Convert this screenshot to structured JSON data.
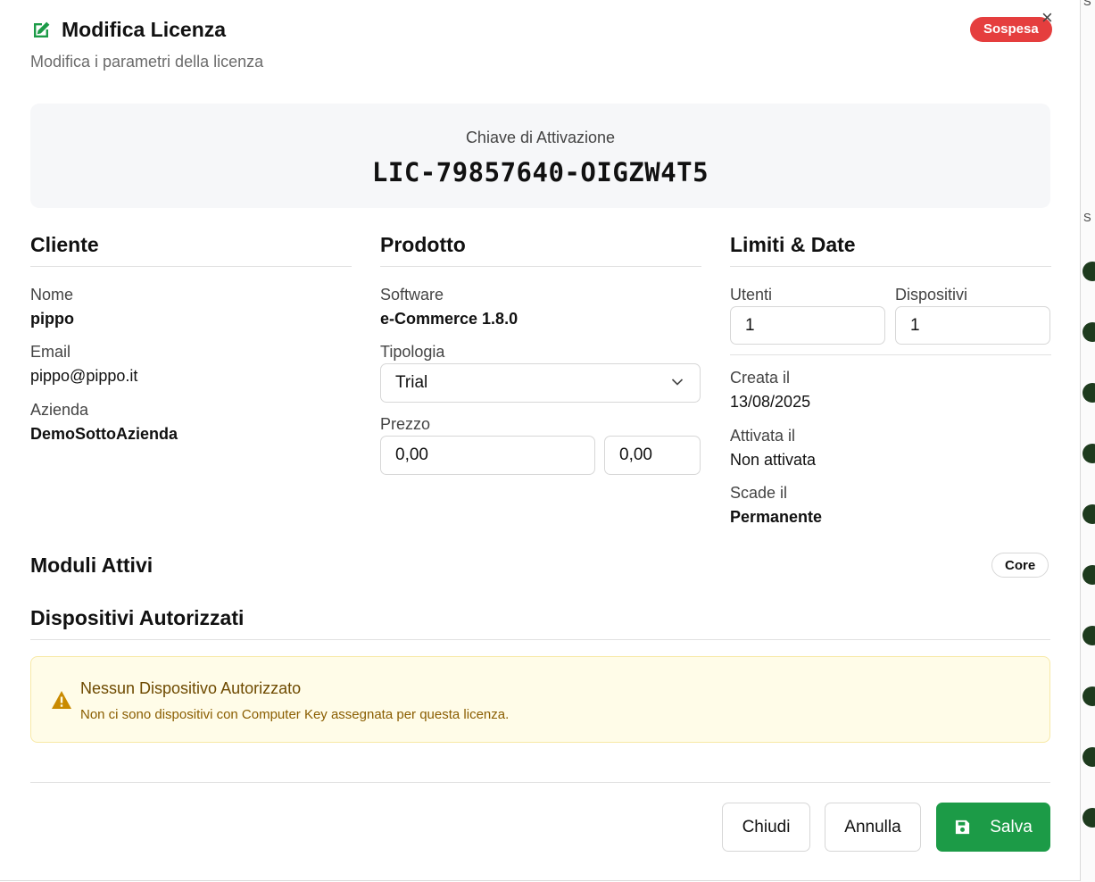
{
  "dialog": {
    "title": "Modifica Licenza",
    "subtitle": "Modifica i parametri della licenza",
    "status_badge": "Sospesa",
    "close_glyph": "×"
  },
  "activation": {
    "label": "Chiave di Attivazione",
    "key": "LIC-79857640-OIGZW4T5"
  },
  "cliente": {
    "heading": "Cliente",
    "nome_label": "Nome",
    "nome_value": "pippo",
    "email_label": "Email",
    "email_value": "pippo@pippo.it",
    "azienda_label": "Azienda",
    "azienda_value": "DemoSottoAzienda"
  },
  "prodotto": {
    "heading": "Prodotto",
    "software_label": "Software",
    "software_value": "e-Commerce 1.8.0",
    "tipologia_label": "Tipologia",
    "tipologia_value": "Trial",
    "prezzo_label": "Prezzo",
    "prezzo_value": "0,00",
    "prezzo_secondary_value": "0,00"
  },
  "limiti": {
    "heading": "Limiti & Date",
    "utenti_label": "Utenti",
    "utenti_value": "1",
    "dispositivi_label": "Dispositivi",
    "dispositivi_value": "1",
    "creata_label": "Creata il",
    "creata_value": "13/08/2025",
    "attivata_label": "Attivata il",
    "attivata_value": "Non attivata",
    "scade_label": "Scade il",
    "scade_value": "Permanente"
  },
  "moduli": {
    "heading": "Moduli Attivi",
    "items": [
      "Core"
    ]
  },
  "dispositivi": {
    "heading": "Dispositivi Autorizzati",
    "alert_title": "Nessun Dispositivo Autorizzato",
    "alert_text": "Non ci sono dispositivi con Computer Key assegnata per questa licenza."
  },
  "footer": {
    "chiudi_label": "Chiudi",
    "annulla_label": "Annulla",
    "salva_label": "Salva"
  },
  "icons": {
    "title": "edit-icon",
    "alert": "warning-icon",
    "save": "save-icon",
    "select": "chevron-down-icon"
  },
  "colors": {
    "accent_green": "#1c9b47",
    "badge_red": "#e53e3e",
    "alert_background": "#fffce8",
    "alert_text": "#8a5d00"
  },
  "background_fragments": [
    "S",
    "S"
  ]
}
